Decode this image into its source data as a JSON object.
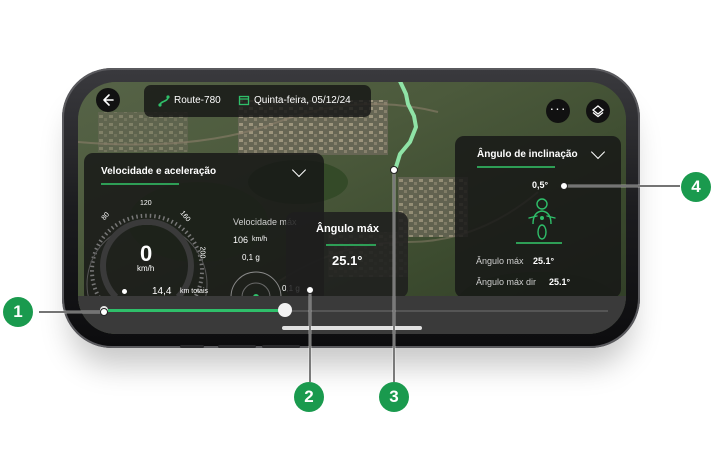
{
  "route": {
    "name": "Route-780",
    "date": "Quinta-feira, 05/12/24"
  },
  "speed_panel": {
    "title": "Velocidade e aceleração",
    "dial_ticks": [
      "80",
      "120",
      "160",
      "200"
    ],
    "speed_value": "0",
    "speed_unit": "km/h",
    "max_speed_label": "Velocidade máx",
    "max_speed_value": "106",
    "max_speed_unit": "km/h",
    "g_value_1": "0,1 g",
    "g_value_2": "0,1 g",
    "distance_value": "14,4",
    "distance_label": "km totais"
  },
  "max_angle_panel": {
    "title": "Ângulo máx",
    "value": "25.1°"
  },
  "lean_panel": {
    "title": "Ângulo de inclinação",
    "current_value": "0,5°",
    "max_label": "Ângulo máx",
    "max_value": "25.1°",
    "max_right_label": "Ângulo máx dir",
    "max_right_value": "25.1°"
  },
  "timeline": {
    "progress": 0.36
  },
  "callouts": [
    "1",
    "2",
    "3",
    "4"
  ],
  "colors": {
    "accent": "#1a9a4e",
    "panel": "#161616",
    "route": "#8fe3a6"
  },
  "icons": [
    "back-arrow-icon",
    "route-icon",
    "calendar-icon",
    "more-icon",
    "layers-icon",
    "chevron-down-icon",
    "motorcycle-rider-icon"
  ]
}
